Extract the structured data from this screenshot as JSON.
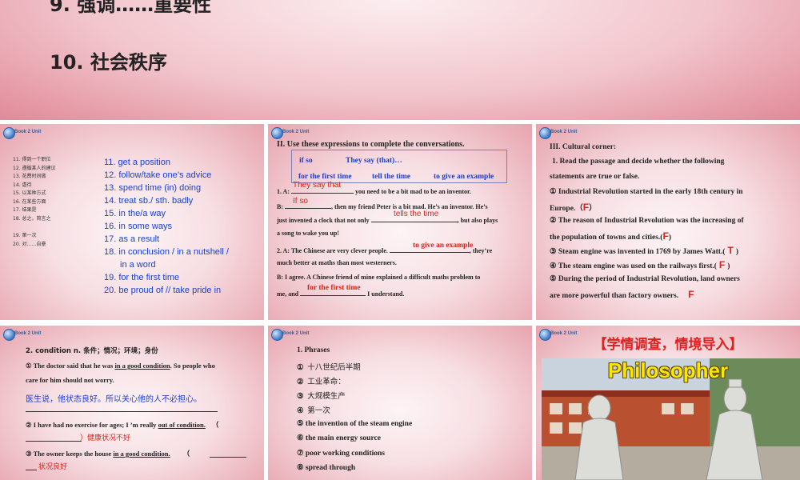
{
  "top_slide": {
    "item9": "9. 强调……重要性",
    "item10": "10. 社会秩序"
  },
  "slide_phrases": {
    "cn_items": [
      "11. 得到一个职位",
      "12. 遵循某人的建议",
      "13. 花费时间做",
      "14. 虐待",
      "15. 以某种方式",
      "16. 在某些方面",
      "17. 结果是",
      "18. 总之，简言之",
      "19. 第一次",
      "20. 对……自豪"
    ],
    "en_items": [
      "11. get a position",
      "12. follow/take one’s advice",
      "13. spend time (in) doing",
      "14. treat sb./ sth. badly",
      "15. in the/a way",
      "16. in some ways",
      "17. as a result",
      "18. in conclusion / in a nutshell /",
      "in a word",
      "19. for the first time",
      "20. be proud of // take pride in"
    ]
  },
  "slide_conversations": {
    "title": "II. Use these expressions to complete the conversations.",
    "expressions": [
      "if so",
      "They say (that)…",
      "for the first time",
      "tell the time",
      "to give an example"
    ],
    "lines": {
      "a1_prefix": "1. A:",
      "a1_rest": "you need to be a bit mad to be an inventor.",
      "b1_prefix": "B:",
      "b1_rest": ", then my friend Peter is a bit mad. He’s an inventor. He’s",
      "b1_line2a": "just invented a clock that not only",
      "b1_line2b": ", but also plays",
      "b1_line3": "a song to wake you up!",
      "a2_prefix": "2. A: The Chinese are very clever people.",
      "a2_rest": ", they’re",
      "a2_line2": "much better at maths than most westerners.",
      "b2_line1": "B: I agree. A Chinese friend of mine explained a difficult maths problem to",
      "b2_line2a": "me, and",
      "b2_line2b": "I understand."
    },
    "answers": [
      "They say that",
      "If so",
      "tells the time",
      "to give an example",
      "for the first time"
    ]
  },
  "slide_cultural": {
    "heading": "III. Cultural corner:",
    "instruction_1": "1. Read the passage and decide whether the following",
    "instruction_2": "statements are true or false.",
    "s1a": "① Industrial Revolution started in the early 18th century in",
    "s1b": "Europe.（",
    "s1c": "）",
    "s2a": "② The reason of Industrial Revolution was the increasing of",
    "s2b": "the population of towns and cities.(",
    "s2c": ")",
    "s3a": "③ Steam engine was invented in 1769 by James Watt.(",
    "s3b": ")",
    "s4a": "④ The steam engine was used on the railways first.(",
    "s4b": ")",
    "s5a": "⑤ During the period of Industrial Revolution, land owners",
    "s5b": "are more powerful than factory owners.",
    "answers": [
      "F",
      "F",
      "T",
      "F",
      "F"
    ]
  },
  "slide_condition": {
    "heading": "2. condition  n. 条件；情况；环境；身份",
    "ex1_a": "① The doctor said that he was ",
    "ex1_u": "in a good condition",
    "ex1_b": ". So people who",
    "ex1_c": "care for him should not worry.",
    "ex1_cn": "医生说，他状态良好。所以关心他的人不必担心。",
    "ex2_a": "② I have had no exercise for ages; I ’m really ",
    "ex2_u": "out of condition.",
    "ex2_b": "（",
    "ex2_ans": "健康状况不好",
    "ex2_close": "）",
    "ex3_a": "③ The owner keeps the house ",
    "ex3_u": "in a good condition.",
    "ex3_b": "（",
    "ex3_ans": "状况良好"
  },
  "slide_phrases2": {
    "heading": "1. Phrases",
    "items": [
      {
        "num": "①",
        "text": "十八世纪后半期"
      },
      {
        "num": "②",
        "text": "工业革命："
      },
      {
        "num": "③",
        "text": "大规模生产"
      },
      {
        "num": "④",
        "text": "第一次"
      },
      {
        "num": "⑤",
        "text": "the invention of the steam engine"
      },
      {
        "num": "⑥",
        "text": "the main energy source"
      },
      {
        "num": "⑦",
        "text": "poor working conditions"
      },
      {
        "num": "⑧",
        "text": "spread  through"
      }
    ]
  },
  "slide_intro": {
    "header": "【学情调查，情境导入】",
    "image_text": "Philosopher"
  },
  "colors": {
    "answer_red": "#e0201c",
    "phrase_blue": "#1a3fcf",
    "slide_pink": "#e7a3ad"
  }
}
